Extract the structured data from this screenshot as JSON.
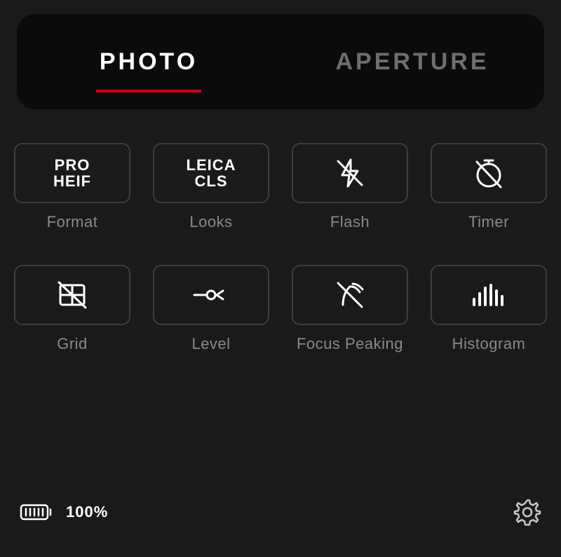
{
  "tabs": [
    {
      "label": "PHOTO",
      "active": true
    },
    {
      "label": "APERTURE",
      "active": false
    }
  ],
  "options": {
    "format": {
      "line1": "PRO",
      "line2": "HEIF",
      "label": "Format"
    },
    "looks": {
      "line1": "LEICA",
      "line2": "CLS",
      "label": "Looks"
    },
    "flash": {
      "label": "Flash"
    },
    "timer": {
      "label": "Timer"
    },
    "grid": {
      "label": "Grid"
    },
    "level": {
      "label": "Level"
    },
    "focusPeaking": {
      "label": "Focus Peaking"
    },
    "histogram": {
      "label": "Histogram"
    }
  },
  "battery": {
    "percent": "100%"
  }
}
